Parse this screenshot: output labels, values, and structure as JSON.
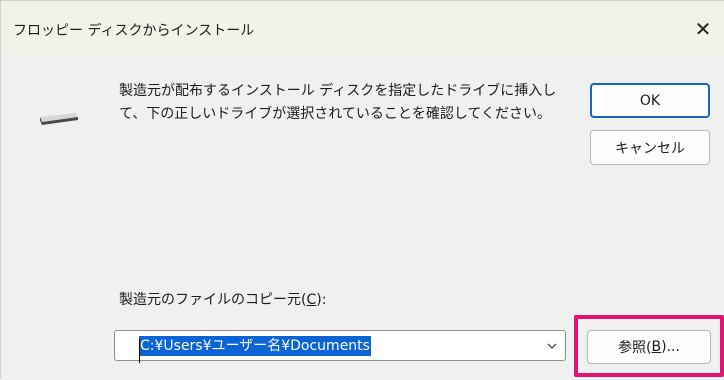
{
  "window": {
    "title": "フロッピー ディスクからインストール",
    "close_glyph": "✕"
  },
  "message": "製造元が配布するインストール ディスクを指定したドライブに挿入して、下の正しいドライブが選択されていることを確認してください。",
  "buttons": {
    "ok": "OK",
    "cancel": "キャンセル",
    "browse_prefix": "参照(",
    "browse_key": "B",
    "browse_suffix": ")..."
  },
  "copy_from": {
    "label_prefix": "製造元のファイルのコピー元(",
    "label_key": "C",
    "label_suffix": "):",
    "value": "C:¥Users¥ユーザー名¥Documents"
  },
  "icons": {
    "drive": "floppy-drive-icon",
    "dropdown": "chevron-down-icon",
    "close": "close-icon"
  },
  "colors": {
    "highlight": "#e4136e",
    "selection": "#0a64d4",
    "default_button_border": "#1a63c7"
  }
}
